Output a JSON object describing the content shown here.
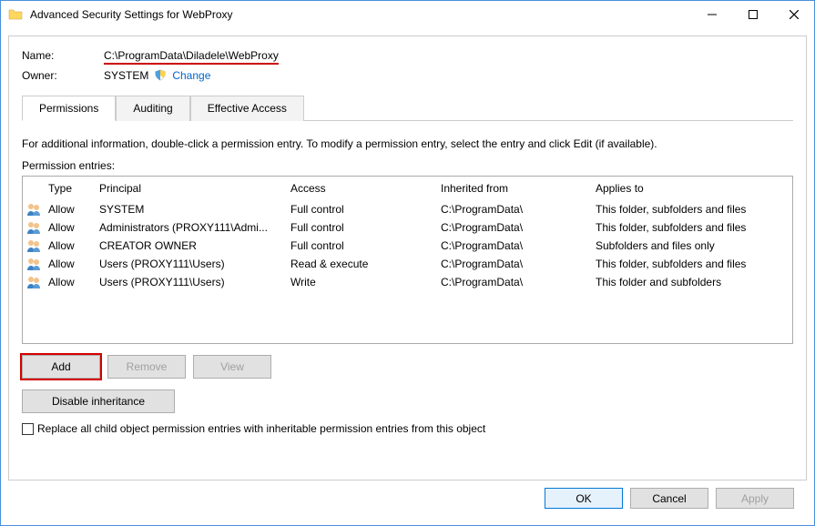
{
  "window": {
    "title": "Advanced Security Settings for WebProxy"
  },
  "labels": {
    "name": "Name:",
    "owner": "Owner:",
    "change": "Change",
    "info": "For additional information, double-click a permission entry. To modify a permission entry, select the entry and click Edit (if available).",
    "entries": "Permission entries:",
    "replace": "Replace all child object permission entries with inheritable permission entries from this object"
  },
  "values": {
    "name": "C:\\ProgramData\\Diladele\\WebProxy",
    "owner": "SYSTEM"
  },
  "tabs": {
    "permissions": "Permissions",
    "auditing": "Auditing",
    "effective": "Effective Access"
  },
  "columns": {
    "type": "Type",
    "principal": "Principal",
    "access": "Access",
    "inherited": "Inherited from",
    "applies": "Applies to"
  },
  "entries": [
    {
      "type": "Allow",
      "principal": "SYSTEM",
      "access": "Full control",
      "inherited": "C:\\ProgramData\\",
      "applies": "This folder, subfolders and files"
    },
    {
      "type": "Allow",
      "principal": "Administrators (PROXY111\\Admi...",
      "access": "Full control",
      "inherited": "C:\\ProgramData\\",
      "applies": "This folder, subfolders and files"
    },
    {
      "type": "Allow",
      "principal": "CREATOR OWNER",
      "access": "Full control",
      "inherited": "C:\\ProgramData\\",
      "applies": "Subfolders and files only"
    },
    {
      "type": "Allow",
      "principal": "Users (PROXY111\\Users)",
      "access": "Read & execute",
      "inherited": "C:\\ProgramData\\",
      "applies": "This folder, subfolders and files"
    },
    {
      "type": "Allow",
      "principal": "Users (PROXY111\\Users)",
      "access": "Write",
      "inherited": "C:\\ProgramData\\",
      "applies": "This folder and subfolders"
    }
  ],
  "buttons": {
    "add": "Add",
    "remove": "Remove",
    "view": "View",
    "disable": "Disable inheritance",
    "ok": "OK",
    "cancel": "Cancel",
    "apply": "Apply"
  }
}
